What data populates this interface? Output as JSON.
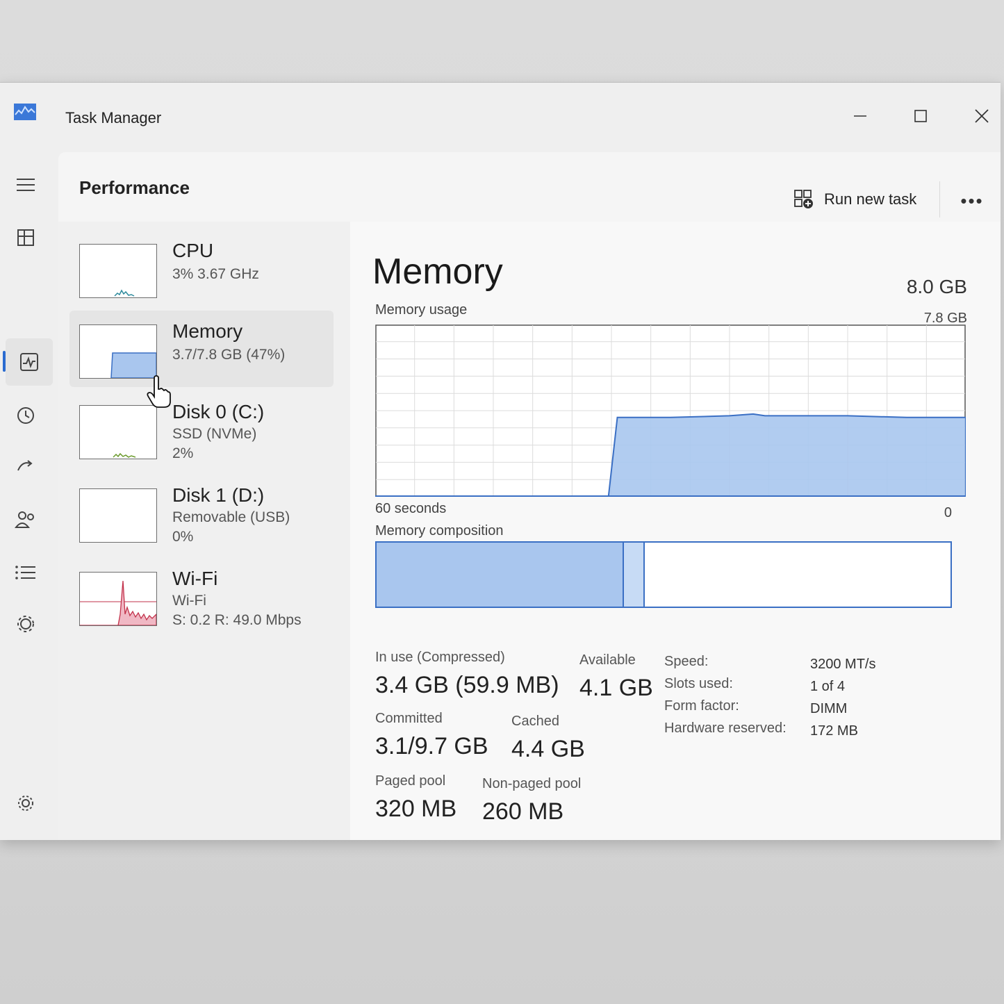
{
  "window": {
    "title": "Task Manager"
  },
  "header": {
    "page_title": "Performance",
    "run_new_task": "Run new task",
    "more": "•••"
  },
  "sidebar": {
    "items": [
      {
        "name": "CPU",
        "sub1": "3% 3.67 GHz",
        "sub2": ""
      },
      {
        "name": "Memory",
        "sub1": "3.7/7.8 GB (47%)",
        "sub2": ""
      },
      {
        "name": "Disk 0 (C:)",
        "sub1": "SSD (NVMe)",
        "sub2": "2%"
      },
      {
        "name": "Disk 1 (D:)",
        "sub1": "Removable (USB)",
        "sub2": "0%"
      },
      {
        "name": "Wi-Fi",
        "sub1": "Wi-Fi",
        "sub2": "S: 0.2 R: 49.0 Mbps"
      }
    ]
  },
  "memory": {
    "title": "Memory",
    "total": "8.0 GB",
    "usage_label": "Memory usage",
    "usage_max": "7.8 GB",
    "time_span": "60 seconds",
    "time_end": "0",
    "composition_label": "Memory composition",
    "stats": {
      "in_use_label": "In use (Compressed)",
      "in_use_value": "3.4 GB (59.9 MB)",
      "available_label": "Available",
      "available_value": "4.1 GB",
      "committed_label": "Committed",
      "committed_value": "3.1/9.7 GB",
      "cached_label": "Cached",
      "cached_value": "4.4 GB",
      "paged_label": "Paged pool",
      "paged_value": "320 MB",
      "nonpaged_label": "Non-paged pool",
      "nonpaged_value": "260 MB"
    },
    "details": [
      {
        "key": "Speed:",
        "value": "3200 MT/s"
      },
      {
        "key": "Slots used:",
        "value": "1 of 4"
      },
      {
        "key": "Form factor:",
        "value": "DIMM"
      },
      {
        "key": "Hardware reserved:",
        "value": "172 MB"
      }
    ]
  },
  "colors": {
    "accent": "#2a6bd0",
    "memory_fill": "#a9c6ee",
    "memory_line": "#3a6fc4",
    "wifi_line": "#c2314a",
    "wifi_fill": "#f0b8c4"
  }
}
